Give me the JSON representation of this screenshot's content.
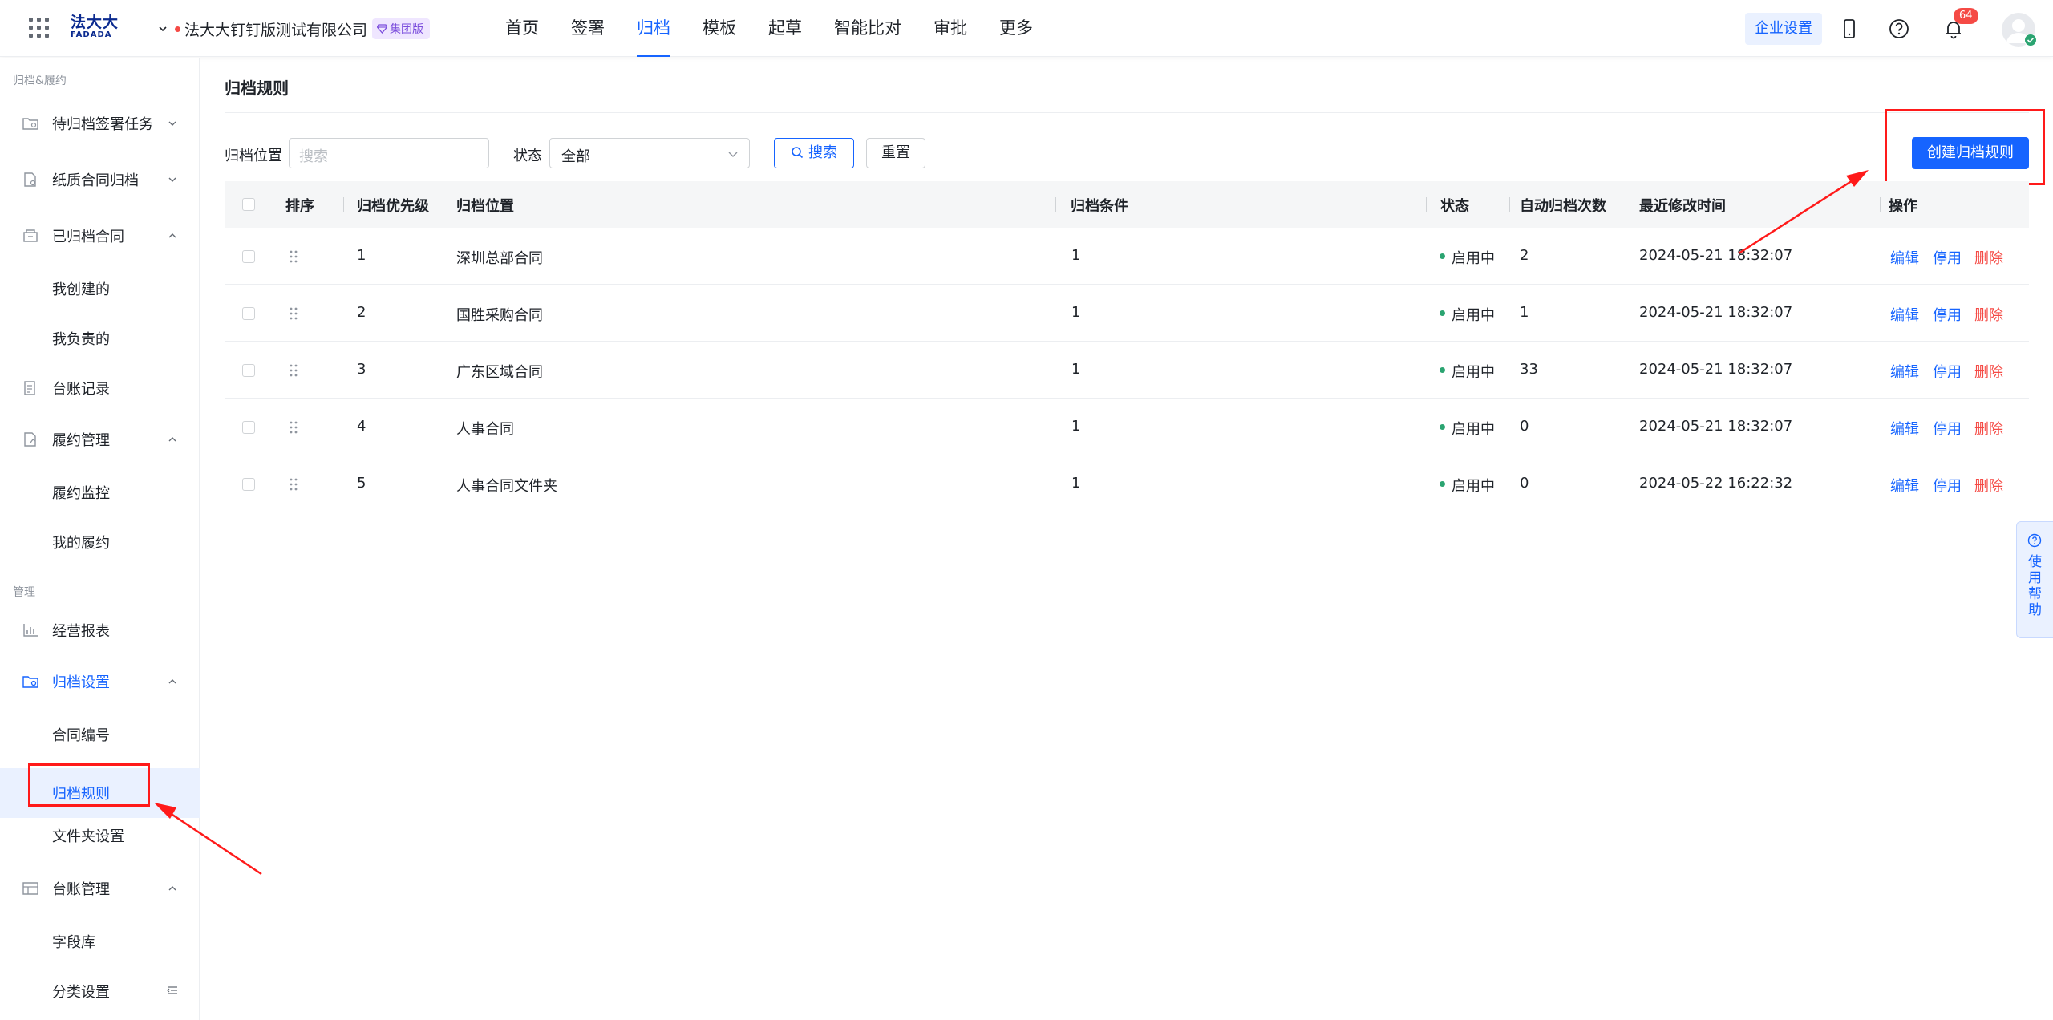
{
  "header": {
    "logo_cn": "法大大",
    "logo_en": "FADADA",
    "org_name": "法大大钉钉版测试有限公司",
    "org_badge": "集团版",
    "nav": [
      "首页",
      "签署",
      "归档",
      "模板",
      "起草",
      "智能比对",
      "审批",
      "更多"
    ],
    "active_nav": "归档",
    "company_settings": "企业设置",
    "notification_count": "64"
  },
  "sidebar": {
    "group_archive": "归档&履约",
    "pending_tasks": "待归档签署任务",
    "paper_archive": "纸质合同归档",
    "archived": "已归档合同",
    "created_by_me": "我创建的",
    "responsible_by_me": "我负责的",
    "ledger_records": "台账记录",
    "fulfillment_mgmt": "履约管理",
    "fulfillment_monitor": "履约监控",
    "my_fulfillment": "我的履约",
    "group_manage": "管理",
    "business_report": "经营报表",
    "archive_settings": "归档设置",
    "contract_number": "合同编号",
    "archive_rules": "归档规则",
    "folder_settings": "文件夹设置",
    "ledger_mgmt": "台账管理",
    "field_library": "字段库",
    "category_settings": "分类设置"
  },
  "main": {
    "title": "归档规则",
    "filter_location_label": "归档位置",
    "search_placeholder": "搜索",
    "status_label": "状态",
    "status_value": "全部",
    "search_button": "搜索",
    "reset_button": "重置",
    "create_button": "创建归档规则"
  },
  "table": {
    "columns": {
      "order": "排序",
      "priority": "归档优先级",
      "location": "归档位置",
      "condition": "归档条件",
      "status": "状态",
      "auto_count": "自动归档次数",
      "modified": "最近修改时间",
      "actions": "操作"
    },
    "rows": [
      {
        "priority": "1",
        "location": "深圳总部合同",
        "condition": "1",
        "status": "启用中",
        "auto_count": "2",
        "modified": "2024-05-21 18:32:07"
      },
      {
        "priority": "2",
        "location": "国胜采购合同",
        "condition": "1",
        "status": "启用中",
        "auto_count": "1",
        "modified": "2024-05-21 18:32:07"
      },
      {
        "priority": "3",
        "location": "广东区域合同",
        "condition": "1",
        "status": "启用中",
        "auto_count": "33",
        "modified": "2024-05-21 18:32:07"
      },
      {
        "priority": "4",
        "location": "人事合同",
        "condition": "1",
        "status": "启用中",
        "auto_count": "0",
        "modified": "2024-05-21 18:32:07"
      },
      {
        "priority": "5",
        "location": "人事合同文件夹",
        "condition": "1",
        "status": "启用中",
        "auto_count": "0",
        "modified": "2024-05-22 16:22:32"
      }
    ],
    "action_edit": "编辑",
    "action_disable": "停用",
    "action_delete": "删除"
  },
  "help": {
    "label": "使用帮助"
  },
  "colors": {
    "primary": "#1664ff",
    "danger": "#f54a45",
    "success": "#2ba471",
    "annotation": "#ff1a1a"
  }
}
